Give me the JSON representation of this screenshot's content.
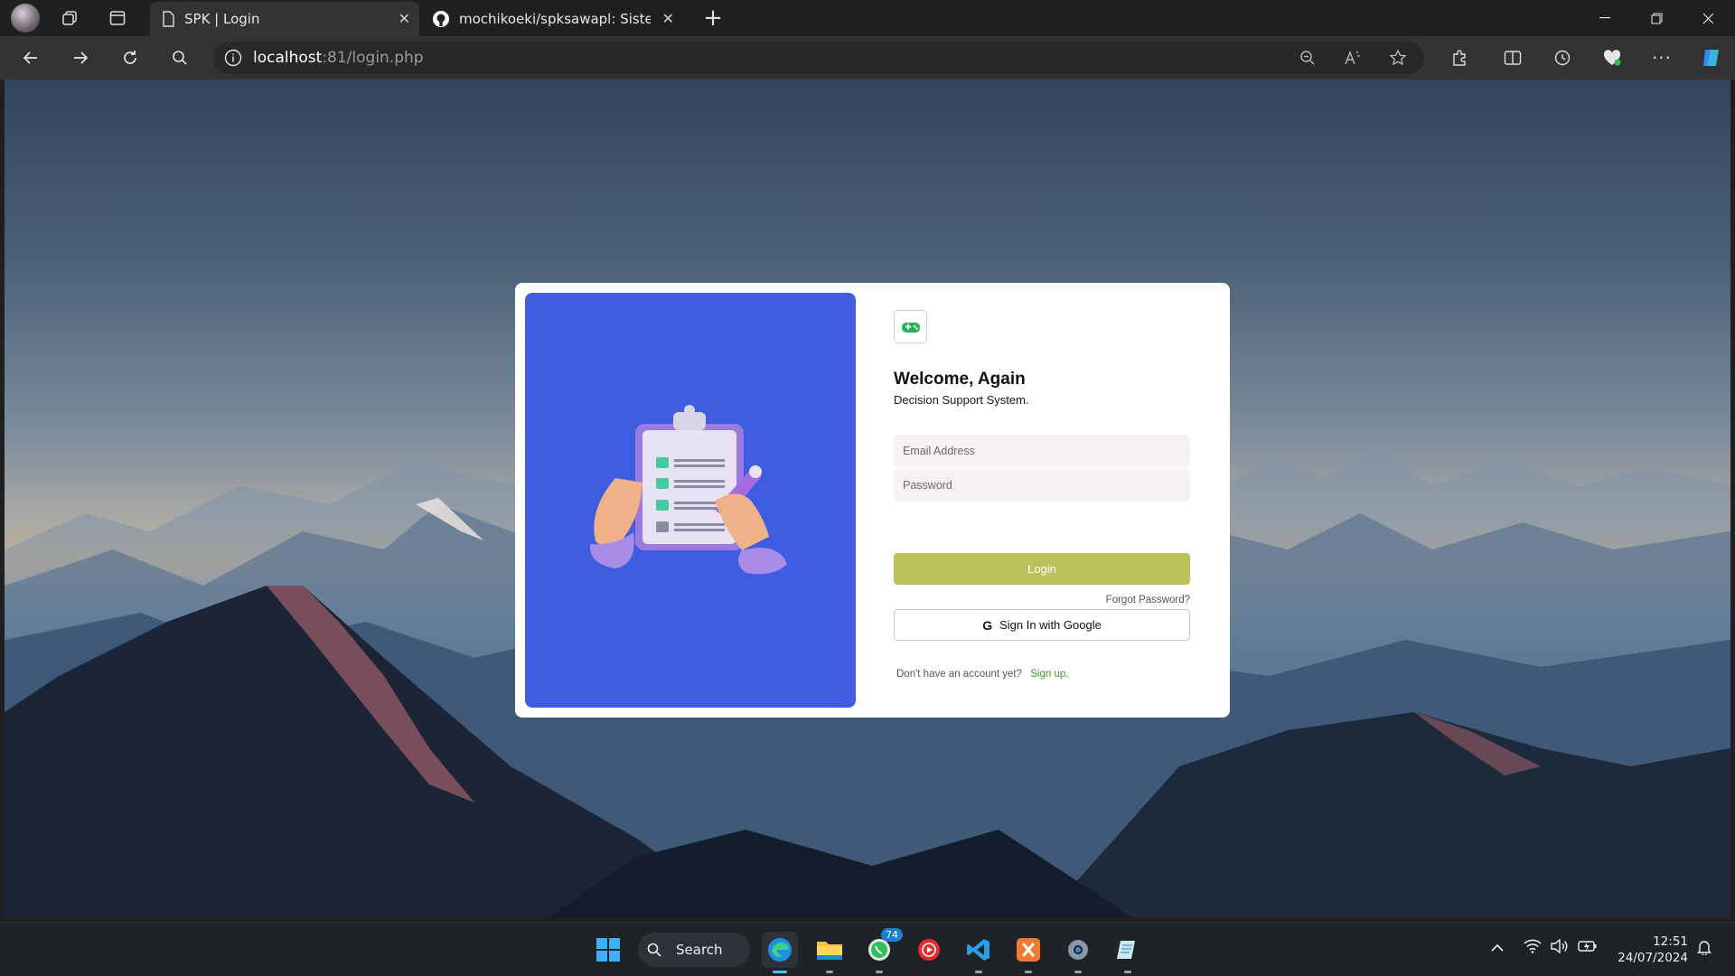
{
  "browser": {
    "tabs": [
      {
        "title": "SPK | Login",
        "active": true
      },
      {
        "title": "mochikoeki/spksawapl: Sistem Pe",
        "active": false
      }
    ],
    "new_tab_label": "+",
    "url_host": "localhost",
    "url_path": ":81/login.php",
    "window_controls": [
      "minimize",
      "restore",
      "close"
    ]
  },
  "login": {
    "welcome": "Welcome, Again",
    "subtitle": "Decision Support System.",
    "email_placeholder": "Email Address",
    "password_placeholder": "Password",
    "login_label": "Login",
    "forgot_label": "Forgot Password?",
    "google_label": "Sign In with Google",
    "google_glyph": "G",
    "signup_prompt": "Don't have an account yet?",
    "signup_link": "Sign up."
  },
  "taskbar": {
    "search_label": "Search",
    "whatsapp_badge": "74",
    "time": "12:51",
    "date": "24/07/2024"
  },
  "colors": {
    "accent_login": "#bcc05a",
    "illustration_panel": "#3f5de0",
    "signup_link": "#3a9a2a"
  }
}
